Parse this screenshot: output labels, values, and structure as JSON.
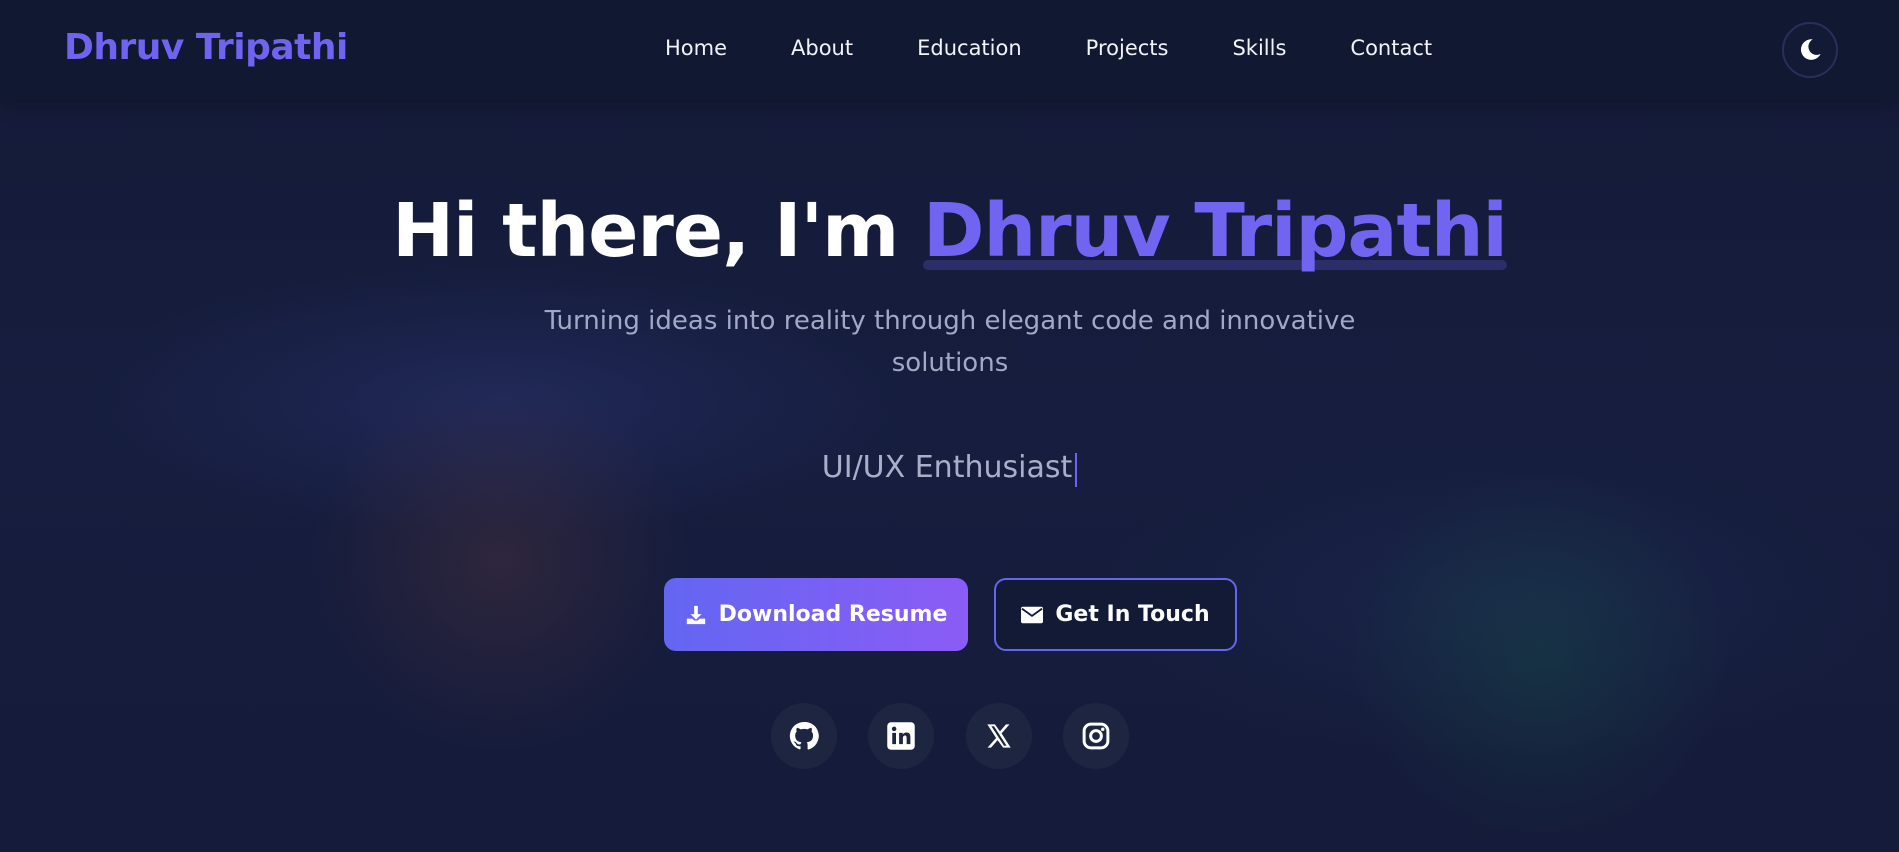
{
  "navbar": {
    "logo": "Dhruv Tripathi",
    "links": [
      "Home",
      "About",
      "Education",
      "Projects",
      "Skills",
      "Contact"
    ],
    "theme_toggle_icon": "moon-icon"
  },
  "hero": {
    "greeting": "Hi there, I'm ",
    "name": "Dhruv Tripathi",
    "subtitle": "Turning ideas into reality through elegant code and innovative solutions",
    "typed_text": "UI/UX Enthusiast"
  },
  "buttons": {
    "download_label": "Download Resume",
    "download_icon": "download-icon",
    "contact_label": "Get In Touch",
    "contact_icon": "envelope-icon"
  },
  "social": [
    "github-icon",
    "linkedin-icon",
    "x-icon",
    "instagram-icon"
  ],
  "colors": {
    "accent": "#6f63f0",
    "background": "#141b38",
    "button_gradient_start": "#6366f1",
    "button_gradient_end": "#8b5cf6"
  }
}
